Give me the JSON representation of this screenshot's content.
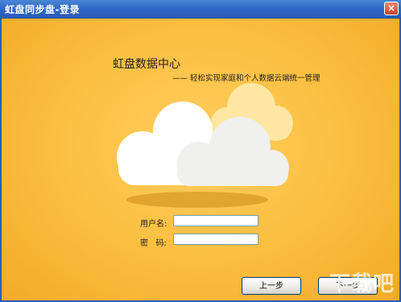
{
  "window": {
    "title": "虹盘同步盘-登录",
    "close_glyph": "×"
  },
  "hero": {
    "heading": "虹盘数据中心",
    "subheading": "—— 轻松实现家庭和个人数据云端统一管理"
  },
  "form": {
    "username_label": "用户名:",
    "username_value": "",
    "password_label": "密   码:",
    "password_value": ""
  },
  "buttons": {
    "prev": "上一步",
    "next": "下一步"
  },
  "watermark": "下载吧",
  "colors": {
    "titlebar": "#2d66c4",
    "background": "#f8b838",
    "cloud": "#ffffff",
    "cloud_back": "#ffe6a3"
  }
}
